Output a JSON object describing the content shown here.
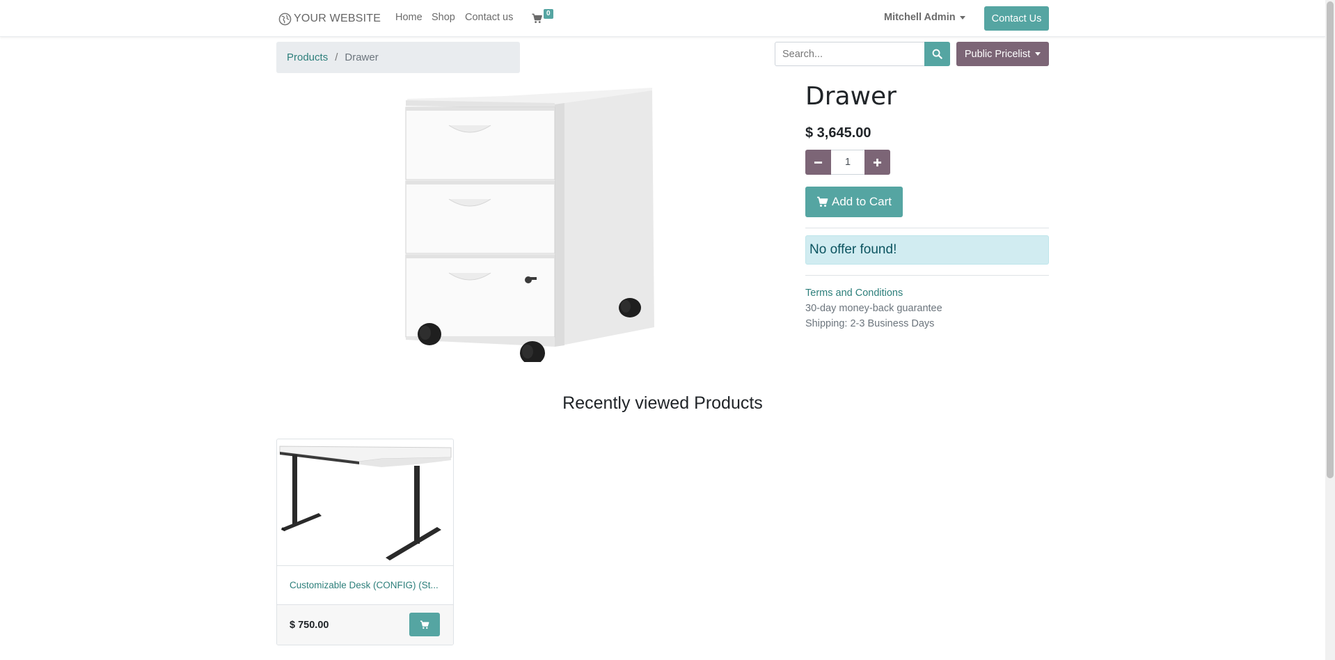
{
  "header": {
    "logo_text": "YOUR WEBSITE",
    "nav": [
      "Home",
      "Shop",
      "Contact us"
    ],
    "cart_count": "0",
    "user": "Mitchell Admin",
    "contact_button": "Contact Us"
  },
  "breadcrumb": {
    "parent": "Products",
    "separator": "/",
    "current": "Drawer"
  },
  "search": {
    "placeholder": "Search..."
  },
  "pricelist": {
    "label": "Public Pricelist"
  },
  "product": {
    "name": "Drawer",
    "price": "$ 3,645.00",
    "quantity": "1",
    "add_to_cart": "Add to Cart",
    "offer_message": "No offer found!",
    "terms_link": "Terms and Conditions",
    "guarantee": "30-day money-back guarantee",
    "shipping": "Shipping: 2-3 Business Days"
  },
  "recently_viewed": {
    "title": "Recently viewed Products",
    "items": [
      {
        "name": "Customizable Desk (CONFIG) (St...",
        "price": "$ 750.00"
      }
    ]
  },
  "colors": {
    "primary": "#55a5a2",
    "secondary": "#7c6576",
    "link": "#2d7f7b",
    "alert_bg": "#d1ecf1",
    "alert_text": "#0c5460"
  }
}
